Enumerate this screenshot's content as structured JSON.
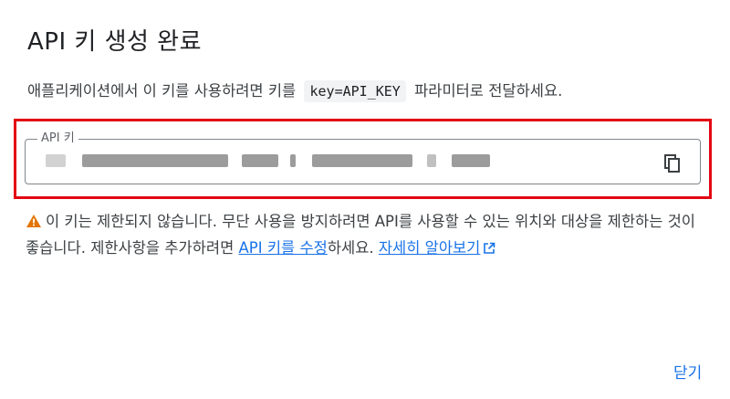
{
  "dialog": {
    "title": "API 키 생성 완료",
    "desc_before": "애플리케이션에서 이 키를 사용하려면 키를",
    "desc_code": "key=API_KEY",
    "desc_after": "파라미터로 전달하세요.",
    "field_label": "API 키",
    "warning_text_1": "이 키는 제한되지 않습니다. 무단 사용을 방지하려면 API를 사용할 수 있는 위치와 대상을 제한하는 것이 좋습니다. 제한사항을 추가하려면 ",
    "warning_link_1": "API 키를 수정",
    "warning_text_2": "하세요. ",
    "warning_link_2": "자세히 알아보기",
    "close_label": "닫기",
    "colors": {
      "accent": "#1a73e8",
      "highlight": "#e30613",
      "warning": "#e37400"
    }
  }
}
